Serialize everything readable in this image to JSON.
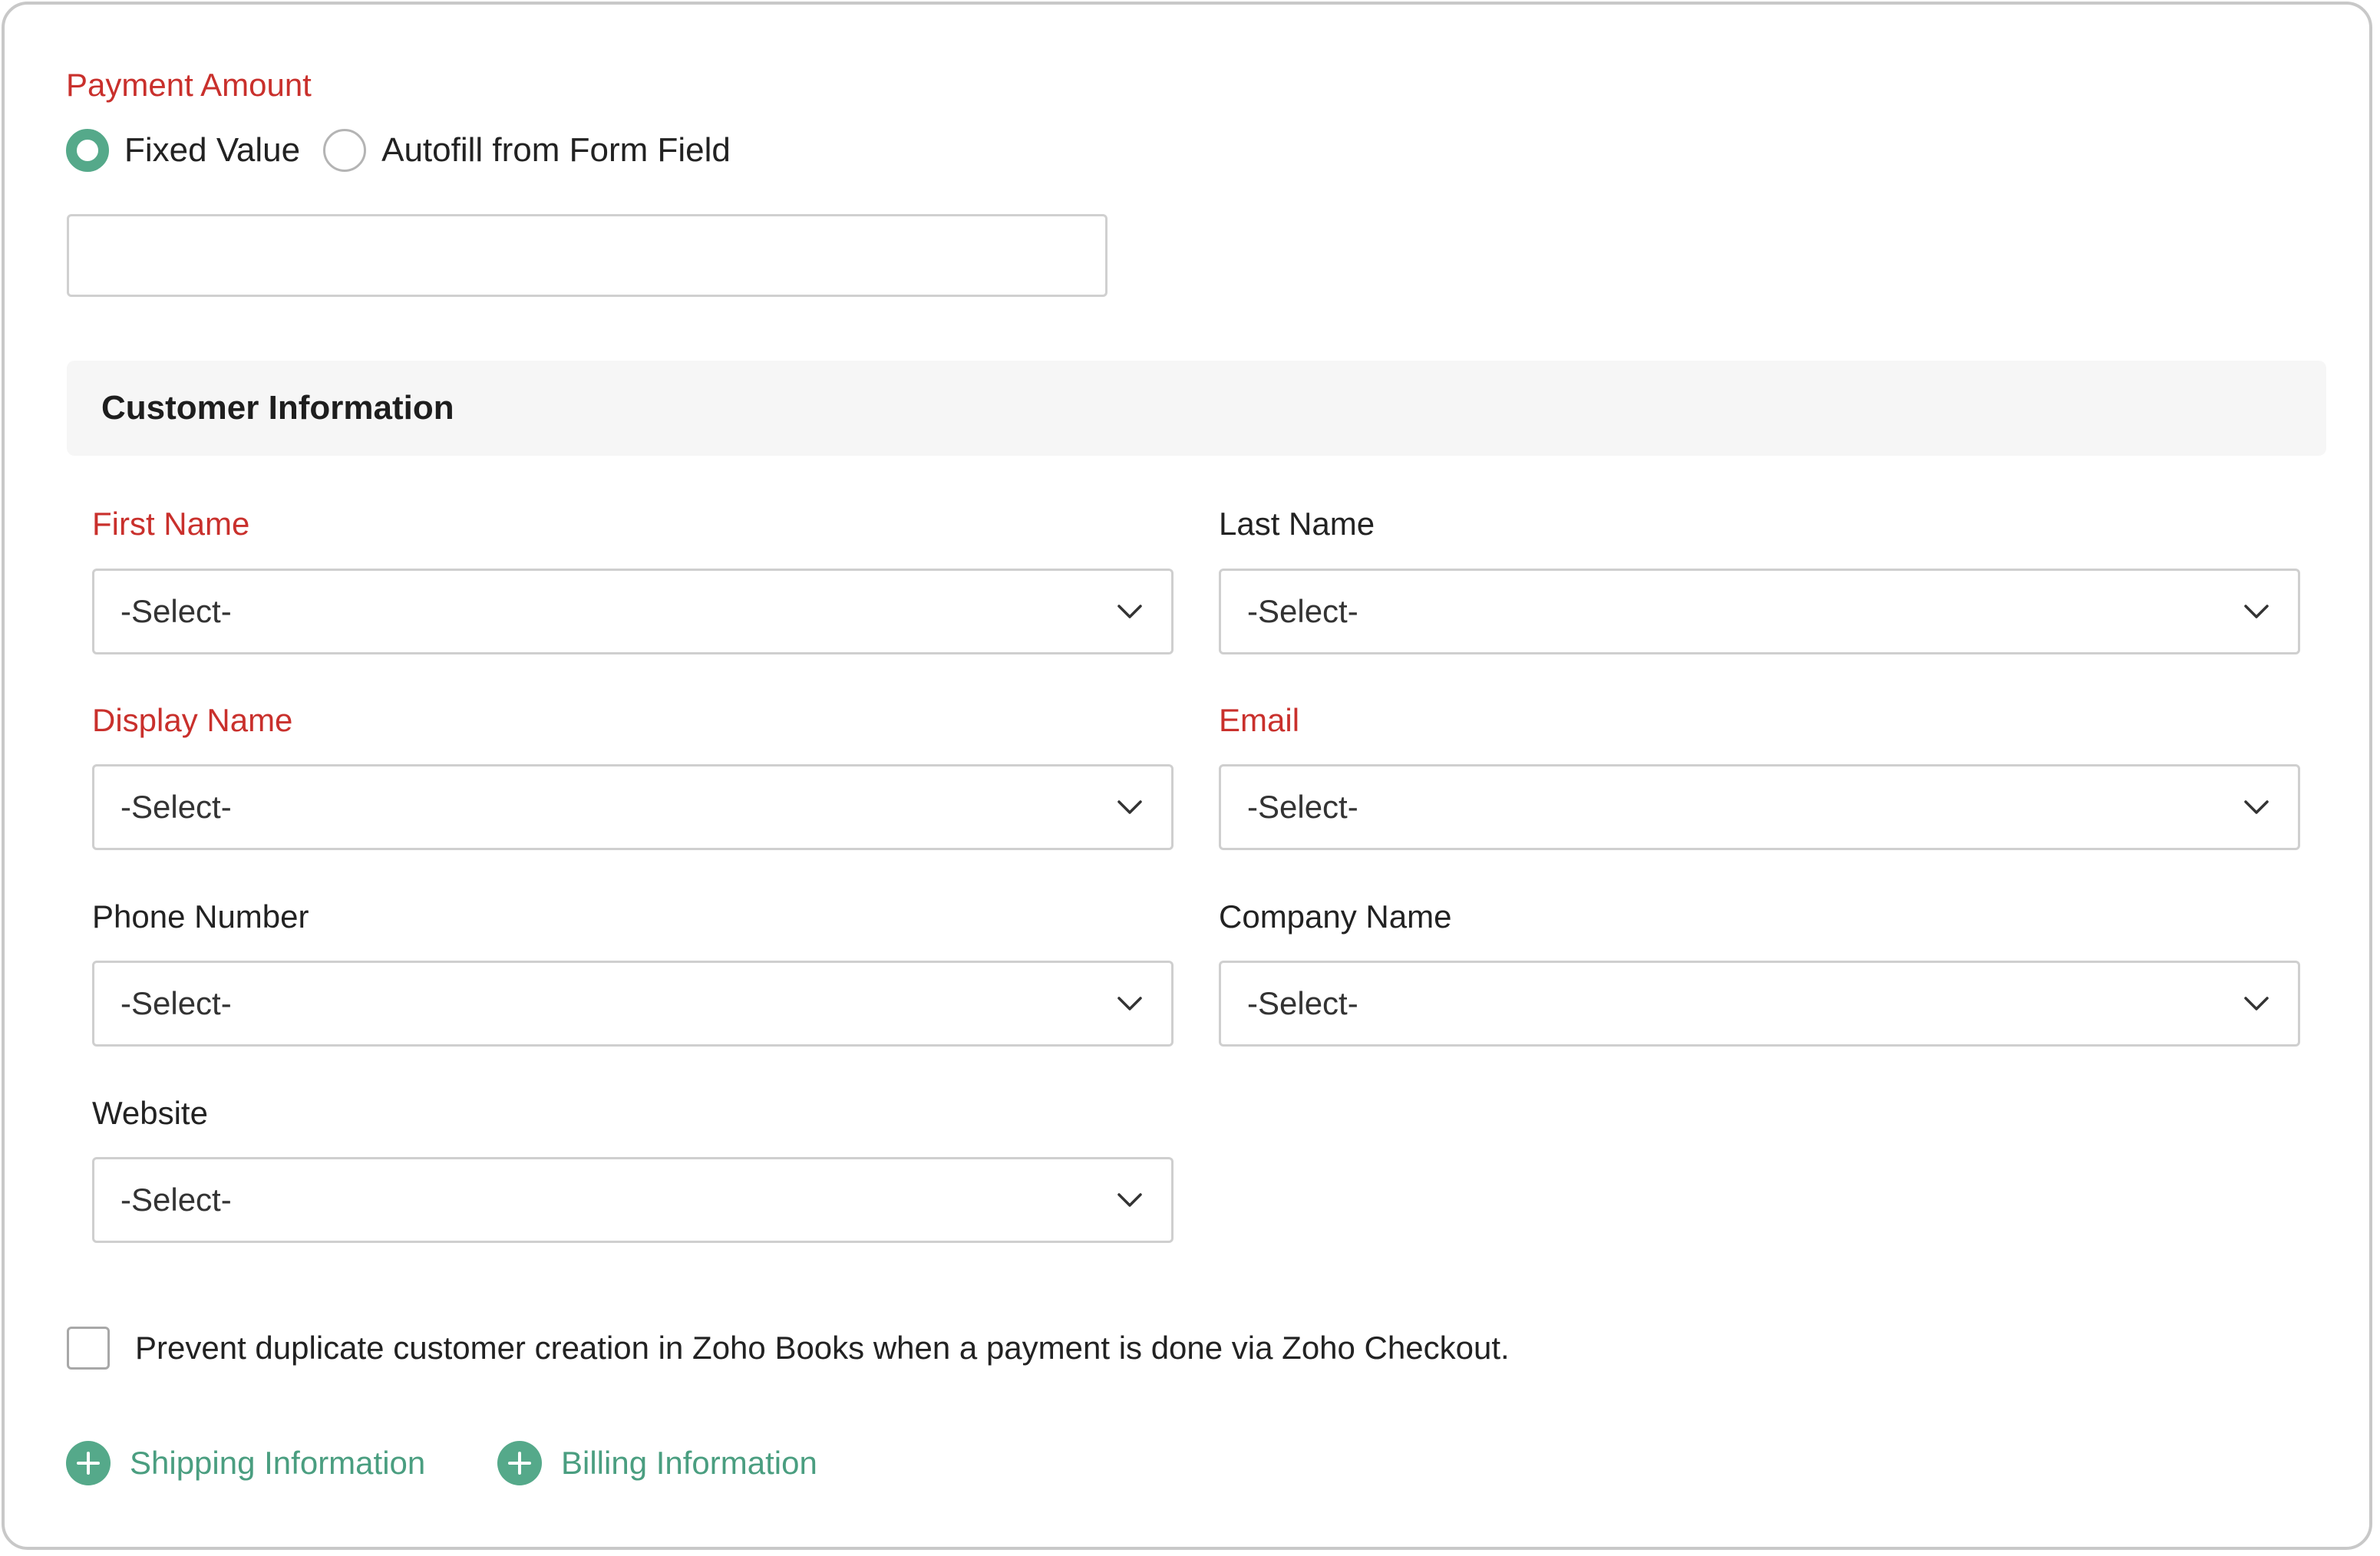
{
  "payment": {
    "label": "Payment Amount",
    "options": [
      {
        "label": "Fixed Value",
        "selected": true
      },
      {
        "label": "Autofill from Form Field",
        "selected": false
      }
    ],
    "amount_value": "",
    "amount_placeholder": ""
  },
  "customer": {
    "section_title": "Customer Information",
    "fields": [
      {
        "label": "First Name",
        "required": true,
        "value": "-Select-"
      },
      {
        "label": "Last Name",
        "required": false,
        "value": "-Select-"
      },
      {
        "label": "Display Name",
        "required": true,
        "value": "-Select-"
      },
      {
        "label": "Email",
        "required": true,
        "value": "-Select-"
      },
      {
        "label": "Phone Number",
        "required": false,
        "value": "-Select-"
      },
      {
        "label": "Company Name",
        "required": false,
        "value": "-Select-"
      },
      {
        "label": "Website",
        "required": false,
        "value": "-Select-"
      }
    ]
  },
  "duplicate_check": {
    "label": "Prevent duplicate customer creation in Zoho Books when a payment is done via Zoho Checkout.",
    "checked": false
  },
  "links": {
    "shipping": "Shipping Information",
    "billing": "Billing Information"
  },
  "colors": {
    "required_label": "#c9302c",
    "accent_green": "#55a98a",
    "link_green": "#4a9e80",
    "section_bg": "#f6f6f6"
  },
  "icons": {
    "select_arrow": "chevron-down-icon",
    "add": "plus-circle-icon"
  }
}
